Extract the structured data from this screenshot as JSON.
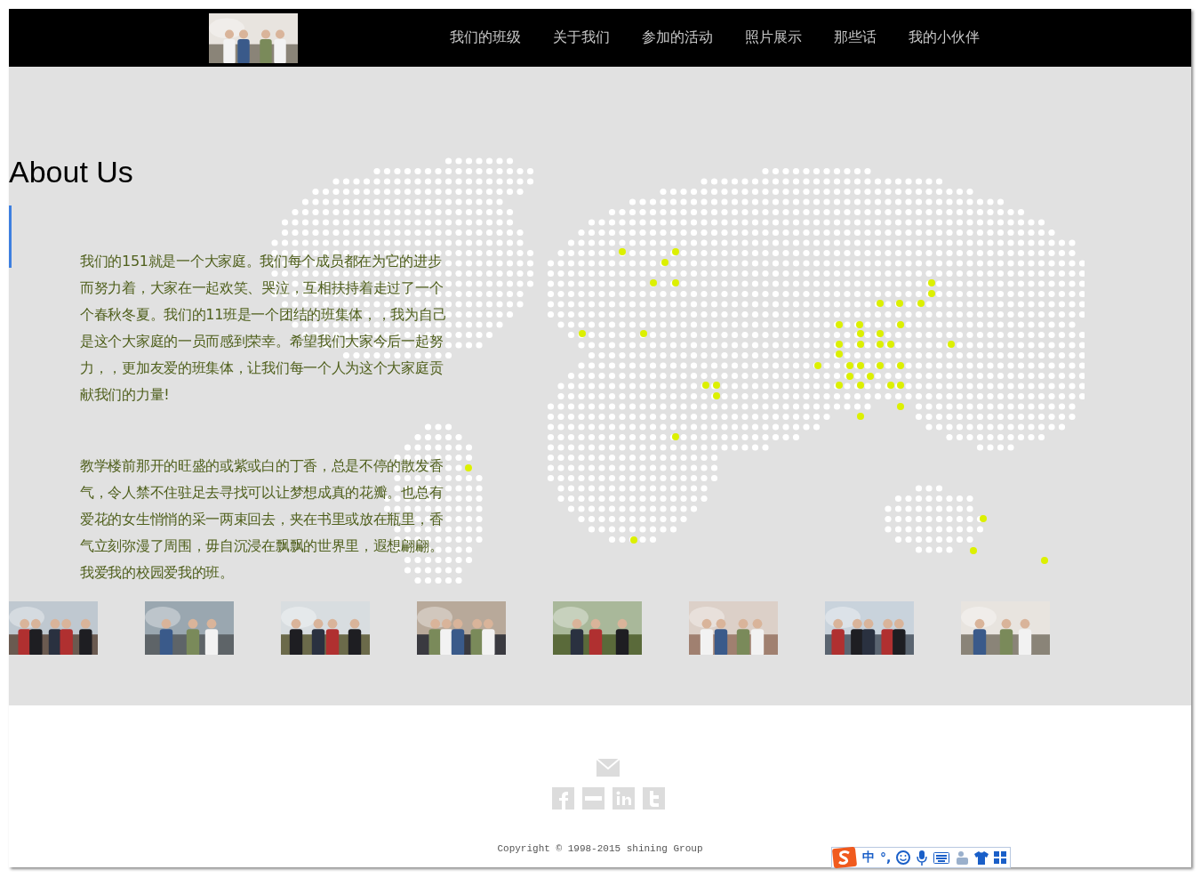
{
  "header": {
    "nav": [
      {
        "label": "我们的班级"
      },
      {
        "label": "关于我们"
      },
      {
        "label": "参加的活动"
      },
      {
        "label": "照片展示"
      },
      {
        "label": "那些话"
      },
      {
        "label": "我的小伙伴"
      }
    ]
  },
  "about": {
    "title": "About Us",
    "paragraphs": [
      "我们的151就是一个大家庭。我们每个成员都在为它的进步而努力着，大家在一起欢笑、哭泣，互相扶持着走过了一个个春秋冬夏。我们的11班是一个团结的班集体，，我为自己是这个大家庭的一员而感到荣幸。希望我们大家今后一起努力，，更加友爱的班集体，让我们每一个人为这个大家庭贡献我们的力量!",
      "教学楼前那开的旺盛的或紫或白的丁香，总是不停的散发香气，令人禁不住驻足去寻找可以让梦想成真的花瓣。也总有爱花的女生悄悄的采一两束回去，夹在书里或放在瓶里，香气立刻弥漫了周围，毋自沉浸在飘飘的世界里，遐想翩翩。我爱我的校园爱我的班。"
    ]
  },
  "footer": {
    "copyright": "Copyright © 1998-2015 shining Group"
  },
  "ime_toolbar": {
    "mode": "中",
    "punctuation": "°,"
  }
}
